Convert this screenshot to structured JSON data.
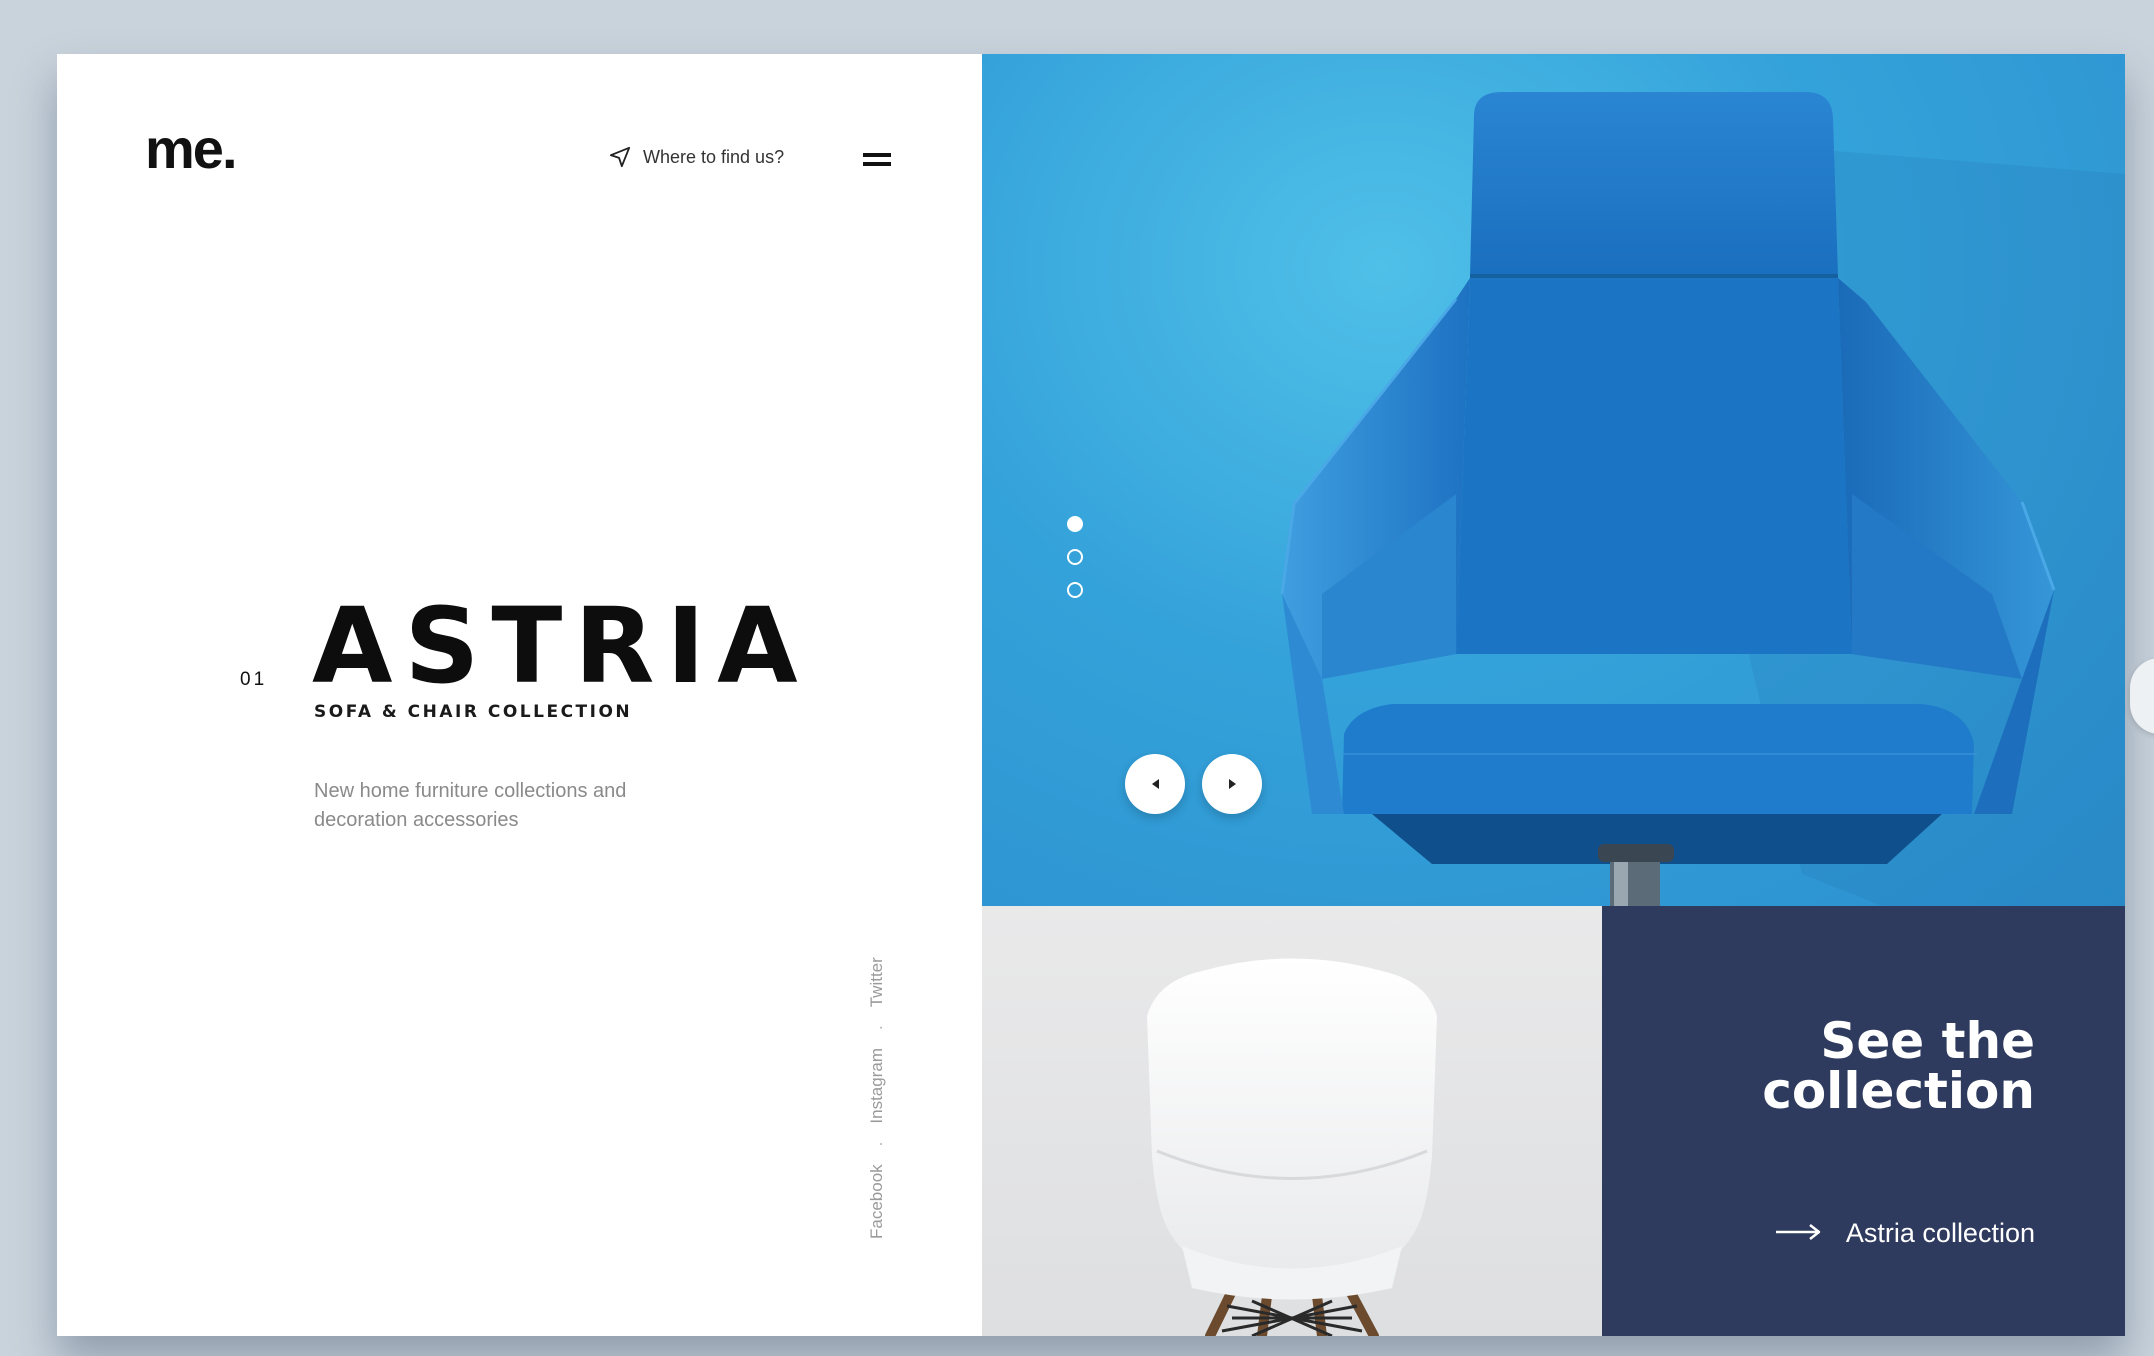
{
  "brand": {
    "logo": "me."
  },
  "header": {
    "find_us_label": "Where to find us?",
    "find_us_icon": "navigation-arrow-icon",
    "menu_icon": "hamburger-menu-icon"
  },
  "hero": {
    "slide_number": "01",
    "title": "ASTRIA",
    "subtitle": "SOFA & CHAIR COLLECTION",
    "description": "New home furniture collections and decoration accessories"
  },
  "social": {
    "items": [
      "Facebook",
      "Instagram",
      "Twitter"
    ],
    "separator": "."
  },
  "slider": {
    "dots": [
      {
        "state": "active"
      },
      {
        "state": "inactive"
      },
      {
        "state": "inactive"
      }
    ],
    "prev_icon": "chevron-left-icon",
    "next_icon": "chevron-right-icon"
  },
  "cta": {
    "title_line1": "See the",
    "title_line2": "collection",
    "link_label": "Astria collection",
    "link_icon": "arrow-right-icon"
  },
  "colors": {
    "page_background": "#c9d3dc",
    "hero_blue": "#34a2da",
    "chair_blue": "#1d79c8",
    "navy_tile": "#2e3a5e",
    "white_tile": "#e4e4e6",
    "text_dark": "#0d0d0d",
    "text_muted": "#8a8a8a"
  }
}
